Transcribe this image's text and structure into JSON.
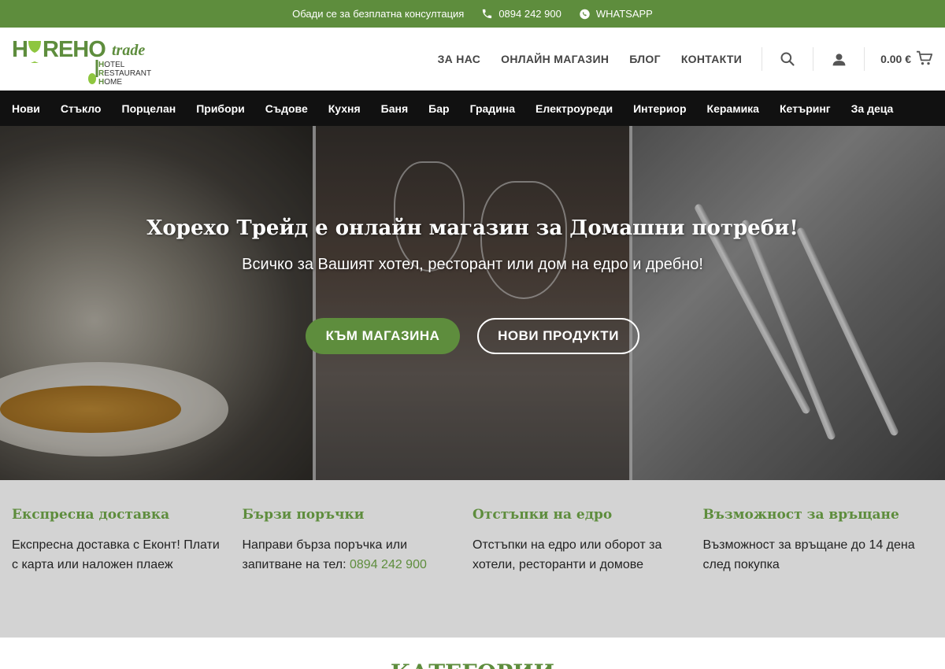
{
  "topbar": {
    "consult_text": "Обади се за безплатна консултация",
    "phone": "0894 242 900",
    "whatsapp": "WHATSAPP",
    "bg_color": "#5e8d3d"
  },
  "logo": {
    "brand": "HOREHO",
    "suffix": "trade",
    "lines": [
      "HOTEL",
      "RESTAURANT",
      "HOME"
    ]
  },
  "header": {
    "nav": [
      "ЗА НАС",
      "ОНЛАЙН МАГАЗИН",
      "БЛОГ",
      "КОНТАКТИ"
    ],
    "cart_total": "0.00 €",
    "icons": [
      "search-icon",
      "user-icon",
      "cart-icon"
    ]
  },
  "categories": [
    "Нови",
    "Стъкло",
    "Порцелан",
    "Прибори",
    "Съдове",
    "Кухня",
    "Баня",
    "Бар",
    "Градина",
    "Електроуреди",
    "Интериор",
    "Керамика",
    "Кетъринг",
    "За деца"
  ],
  "hero": {
    "title": "Хорехо Трейд е онлайн магазин за Домашни потреби!",
    "subtitle": "Всичко за Вашият хотел, ресторант или дом на едро и дребно!",
    "btn_shop": "КЪМ МАГАЗИНА",
    "btn_new": "НОВИ ПРОДУКТИ"
  },
  "features": [
    {
      "title": "Експресна доставка",
      "text": "Експресна доставка с Еконт! Плати с карта или наложен плаеж"
    },
    {
      "title": "Бързи поръчки",
      "text": "Направи бърза поръчка или запитване на тел:",
      "phone": "0894 242 900"
    },
    {
      "title": "Отстъпки на едро",
      "text": "Отстъпки на едро или оборот за хотели, ресторанти и домове"
    },
    {
      "title": "Възможност за връщане",
      "text": "Възможност за връщане до 14 дена след покупка"
    }
  ],
  "bottom_title": "КАТЕГОРИИ",
  "colors": {
    "accent": "#5e8d3d",
    "catnav": "#111111",
    "features_bg": "#d3d3d3"
  }
}
